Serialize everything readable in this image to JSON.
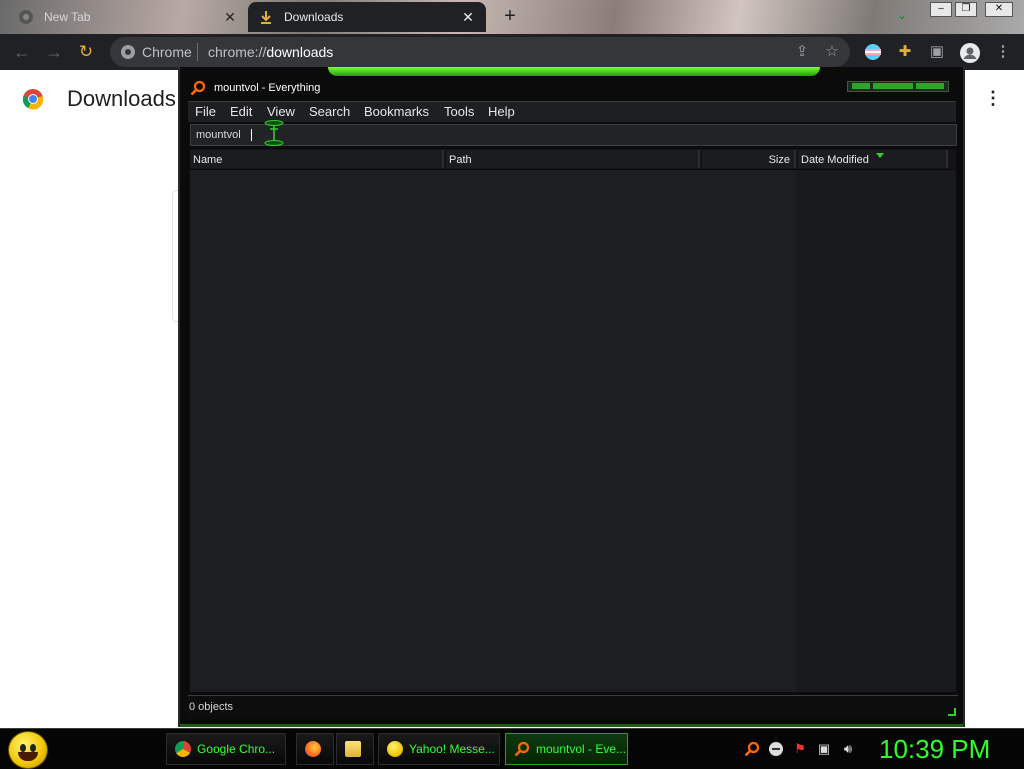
{
  "tabs": [
    {
      "label": "New Tab",
      "icon": "chrome-icon"
    },
    {
      "label": "Downloads",
      "icon": "download-icon",
      "active": true
    }
  ],
  "toolbar": {
    "site_label": "Chrome",
    "url_prefix": "chrome://",
    "url_path": "downloads"
  },
  "page": {
    "heading": "Downloads"
  },
  "everything": {
    "title": "mountvol - Everything",
    "menus": [
      "File",
      "Edit",
      "View",
      "Search",
      "Bookmarks",
      "Tools",
      "Help"
    ],
    "search_value": "mountvol",
    "columns": [
      "Name",
      "Path",
      "Size",
      "Date Modified"
    ],
    "sorted_column": "Date Modified",
    "status": "0 objects",
    "accent_color": "#2fd42a"
  },
  "taskbar": {
    "items": [
      {
        "label": "Google Chro...",
        "icon": "chrome-icon"
      },
      {
        "label": "",
        "icon": "firefox-icon"
      },
      {
        "label": "",
        "icon": "folder-icon"
      },
      {
        "label": "Yahoo! Messe...",
        "icon": "yahoo-messenger-icon"
      },
      {
        "label": "mountvol - Eve...",
        "icon": "everything-search-icon",
        "active": true
      }
    ],
    "clock": "10:39 PM"
  }
}
